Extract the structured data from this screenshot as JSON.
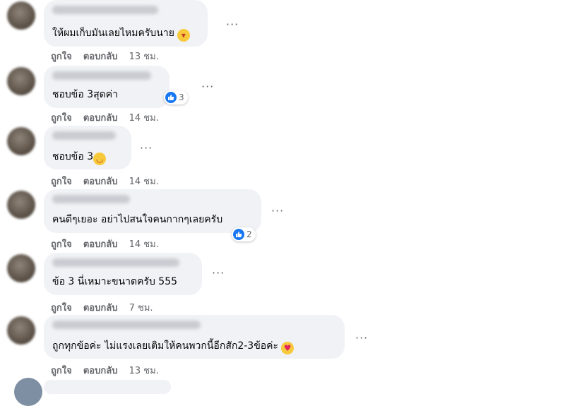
{
  "actions": {
    "like": "ถูกใจ",
    "reply": "ตอบกลับ"
  },
  "comments": [
    {
      "text": "ให้ผมเก็บมันเลยไหมครับนาย",
      "emoji": "laughing-emoji",
      "time": "13 ชม.",
      "reactions": ""
    },
    {
      "text": "ชอบข้อ 3สุดค่า",
      "emoji": "",
      "time": "14 ชม.",
      "reactions": "3"
    },
    {
      "text": "ชอบข้อ 3",
      "emoji": "tears-of-joy-emoji",
      "time": "14 ชม.",
      "reactions": ""
    },
    {
      "text": "คนดีๆเยอะ อย่าไปสนใจคนกากๆเลยครับ",
      "emoji": "",
      "time": "14 ชม.",
      "reactions": "2"
    },
    {
      "text": "ข้อ 3 นี่เหมาะขนาดครับ 555",
      "emoji": "",
      "time": "7 ชม.",
      "reactions": ""
    },
    {
      "text": "ถูกทุกข้อค่ะ ไม่แรงเลยเติมให้คนพวกนี้อีกสัก2-3ข้อค่ะ",
      "emoji": "smiling-face-with-hearts-emoji",
      "time": "13 ชม.",
      "reactions": ""
    }
  ],
  "colors": {
    "bubble": "#f0f2f5",
    "like_blue": "#1877f2",
    "meta_text": "#65676b"
  }
}
